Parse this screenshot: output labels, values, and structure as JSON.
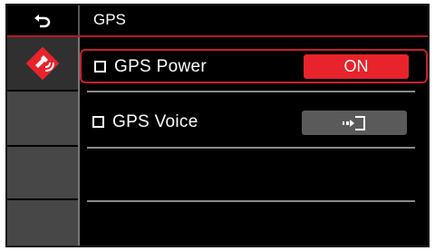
{
  "header": {
    "title": "GPS",
    "back_icon": "back-arrow-icon"
  },
  "sidebar": {
    "items": [
      {
        "icon": "gps-satellite-icon",
        "active": true
      },
      {},
      {},
      {}
    ]
  },
  "settings": [
    {
      "label": "GPS Power",
      "control": "ON",
      "selected": true
    },
    {
      "label": "GPS Voice",
      "control_icon": "enter-icon",
      "selected": false
    }
  ],
  "colors": {
    "accent": "#e8232b",
    "background": "#000000",
    "sidebar": "#474747"
  }
}
